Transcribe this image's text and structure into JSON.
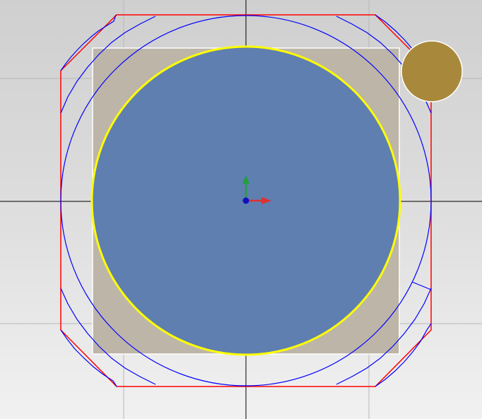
{
  "viewport": {
    "background_top": "#cfcfcf",
    "background_bottom": "#f1f1f1"
  },
  "colors": {
    "grid_line": "#b8b8b8",
    "axis_line": "#000000",
    "stock_rectangle": "#bdb5a8",
    "stock_outline": "#ffffff",
    "part_circle_fill": "#5f7fb0",
    "part_circle_outline": "#ffff00",
    "tool_path": "#0000ff",
    "boundary_path": "#ff0000",
    "tool_marker": "#a8883a",
    "tool_marker_outline": "#ffffff",
    "triad_x_arrow": "#e03030",
    "triad_y_arrow": "#20a040",
    "triad_origin": "#1010c0"
  },
  "icons": {
    "origin_triad": "xyz-axis-triad-icon",
    "tool": "cutting-tool-icon"
  }
}
